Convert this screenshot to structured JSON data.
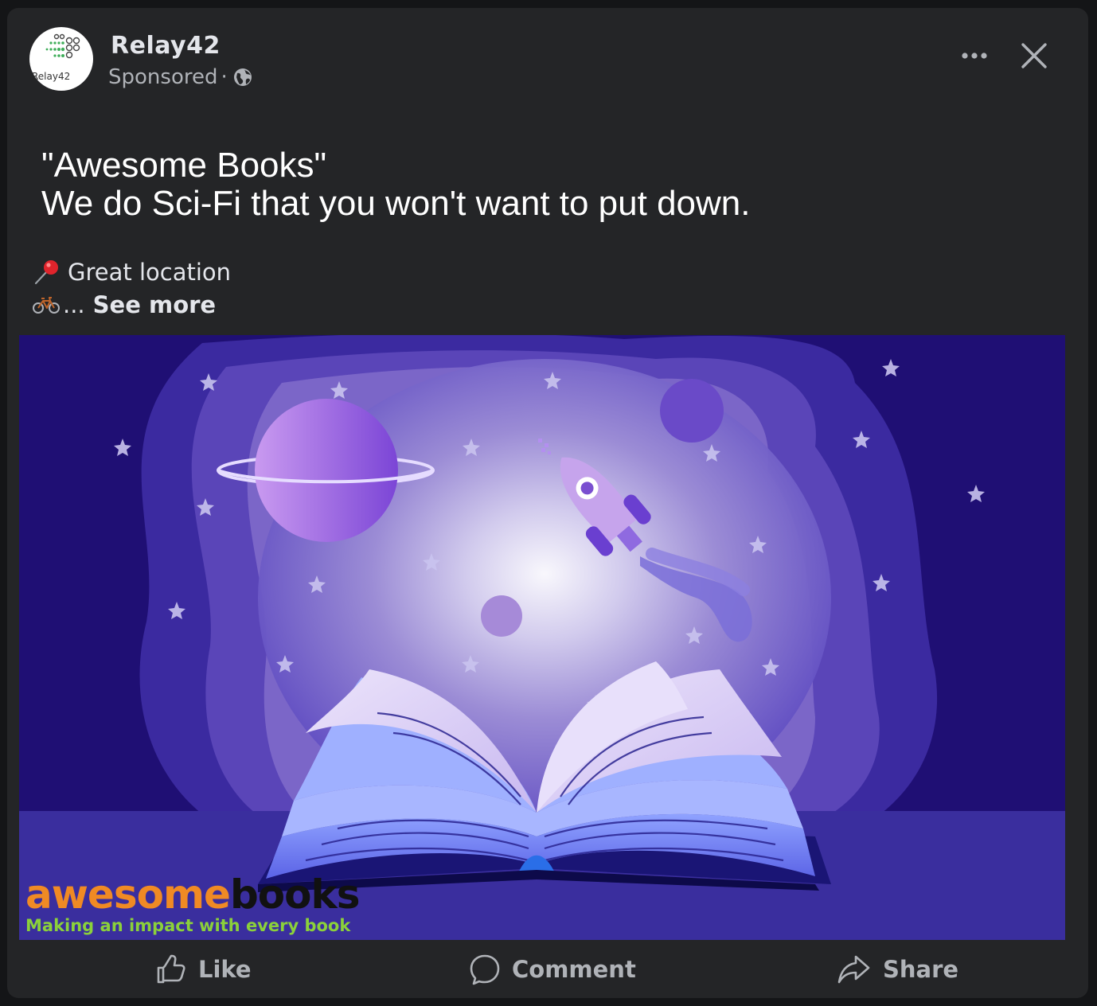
{
  "post": {
    "page_name": "Relay42",
    "avatar_text": "Relay42",
    "sponsored_label": "Sponsored",
    "separator": "·",
    "headline_line1": "\"Awesome Books\"",
    "headline_line2": "We do Sci-Fi that you won't want to put down.",
    "location_text": "Great location",
    "ellipsis": "...",
    "see_more": "See more"
  },
  "ad_image": {
    "brand_part1": "awesome",
    "brand_part2": "books",
    "tagline": "Making an impact with every book"
  },
  "actions": {
    "like": "Like",
    "comment": "Comment",
    "share": "Share"
  },
  "colors": {
    "card_bg": "#242527",
    "text_primary": "#e4e6eb",
    "text_secondary": "#b0b3b8",
    "brand_orange": "#f08a24",
    "brand_green": "#8bd13a"
  }
}
